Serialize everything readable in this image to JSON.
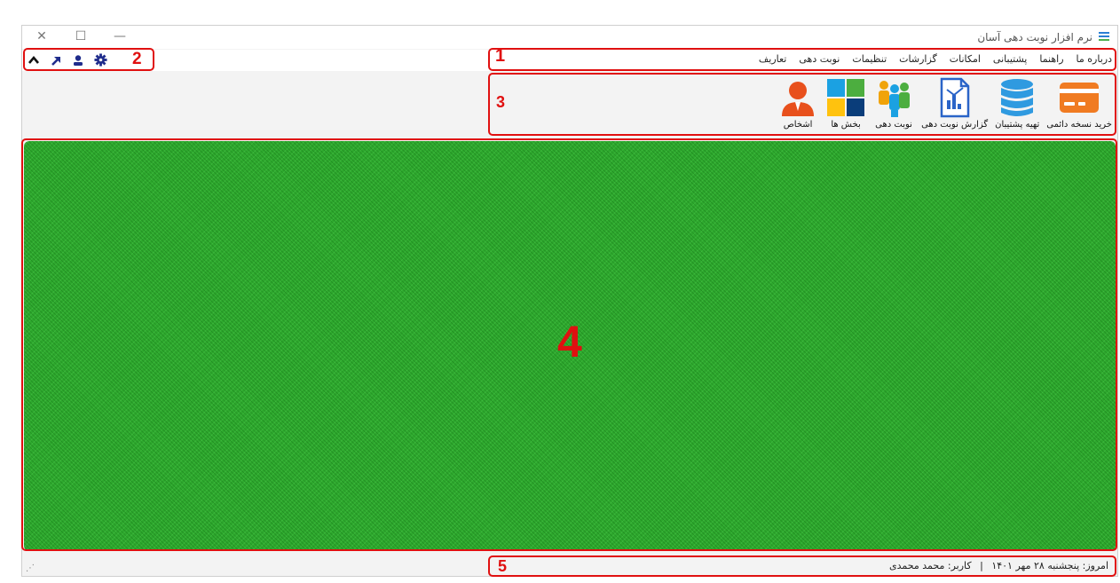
{
  "window": {
    "title": "نرم افزار نوبت دهی آسان",
    "controls": {
      "close": "✕",
      "maximize": "☐",
      "minimize": "—"
    }
  },
  "menu": {
    "items": [
      "تعاریف",
      "نوبت دهی",
      "تنظیمات",
      "گزارشات",
      "امکانات",
      "پشتیبانی",
      "راهنما",
      "درباره ما"
    ]
  },
  "quick_access": {
    "icons": [
      "chevron-up-icon",
      "arrow-up-right-icon",
      "user-icon",
      "gear-icon"
    ],
    "glyphs": {
      "up": "︿",
      "arrow": "↗",
      "user": "👤",
      "gear": "⚙"
    }
  },
  "toolbar": {
    "buttons": [
      {
        "label": "اشخاص",
        "icon": "person-icon",
        "color": "#e8501c"
      },
      {
        "label": "بخش ها",
        "icon": "sections-grid-icon",
        "color": "#1ba1e2"
      },
      {
        "label": "نوبت دهی",
        "icon": "people-group-icon",
        "color": "#f0a30a"
      },
      {
        "label": "گزارش نوبت دهی",
        "icon": "report-icon",
        "color": "#2a64c8"
      },
      {
        "label": "تهیه پشتیبان",
        "icon": "database-icon",
        "color": "#2f9ae0"
      },
      {
        "label": "خرید نسخه دائمی",
        "icon": "credit-card-icon",
        "color": "#f07b22"
      }
    ]
  },
  "annotations": {
    "n1": "1",
    "n2": "2",
    "n3": "3",
    "n4": "4",
    "n5": "5"
  },
  "status": {
    "date": "امروز: پنجشنبه ۲۸ مهر ۱۴۰۱",
    "separator": "|",
    "user": "کاربر: محمد محمدی"
  },
  "colors": {
    "workspace": "#2ea82e",
    "annotation": "#e01010"
  }
}
